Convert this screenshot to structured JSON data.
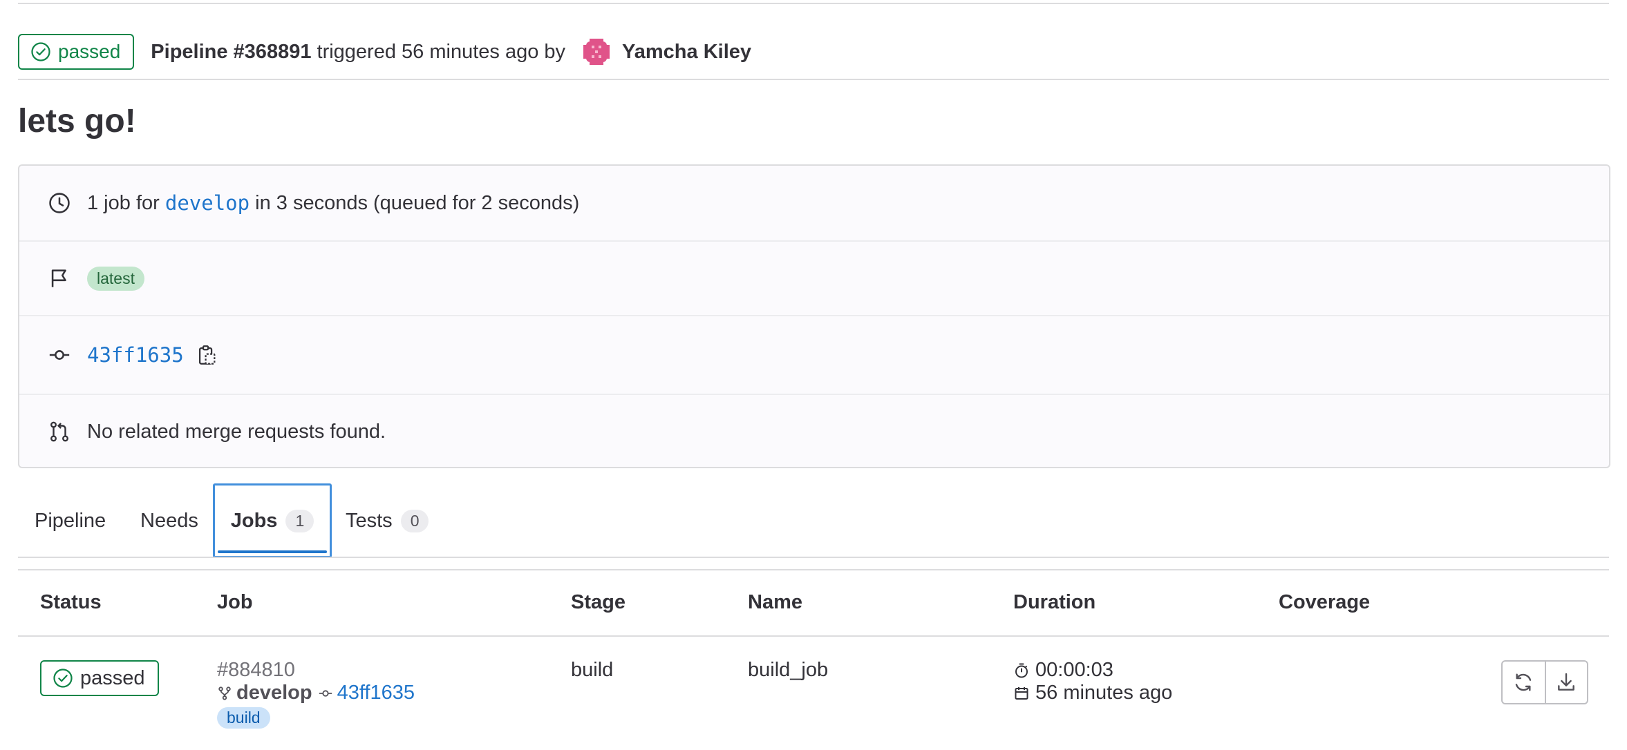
{
  "header": {
    "status": "passed",
    "pipeline_label": "Pipeline #368891",
    "triggered_text": "triggered 56 minutes ago by",
    "author": "Yamcha Kiley"
  },
  "title": "lets go!",
  "info": {
    "summary_prefix": "1 job for",
    "branch": "develop",
    "summary_suffix": "in 3 seconds (queued for 2 seconds)",
    "tag": "latest",
    "commit": "43ff1635",
    "merge_requests": "No related merge requests found."
  },
  "tabs": [
    {
      "label": "Pipeline"
    },
    {
      "label": "Needs"
    },
    {
      "label": "Jobs",
      "count": "1"
    },
    {
      "label": "Tests",
      "count": "0"
    }
  ],
  "table": {
    "headers": [
      "Status",
      "Job",
      "Stage",
      "Name",
      "Duration",
      "Coverage"
    ],
    "rows": [
      {
        "status": "passed",
        "job_id": "#884810",
        "ref": "develop",
        "commit": "43ff1635",
        "stage_badge": "build",
        "stage": "build",
        "name": "build_job",
        "duration": "00:00:03",
        "finished": "56 minutes ago",
        "coverage": ""
      }
    ]
  },
  "colors": {
    "success": "#108548",
    "link": "#1f75cb",
    "tab_focus": "#428fdc"
  }
}
